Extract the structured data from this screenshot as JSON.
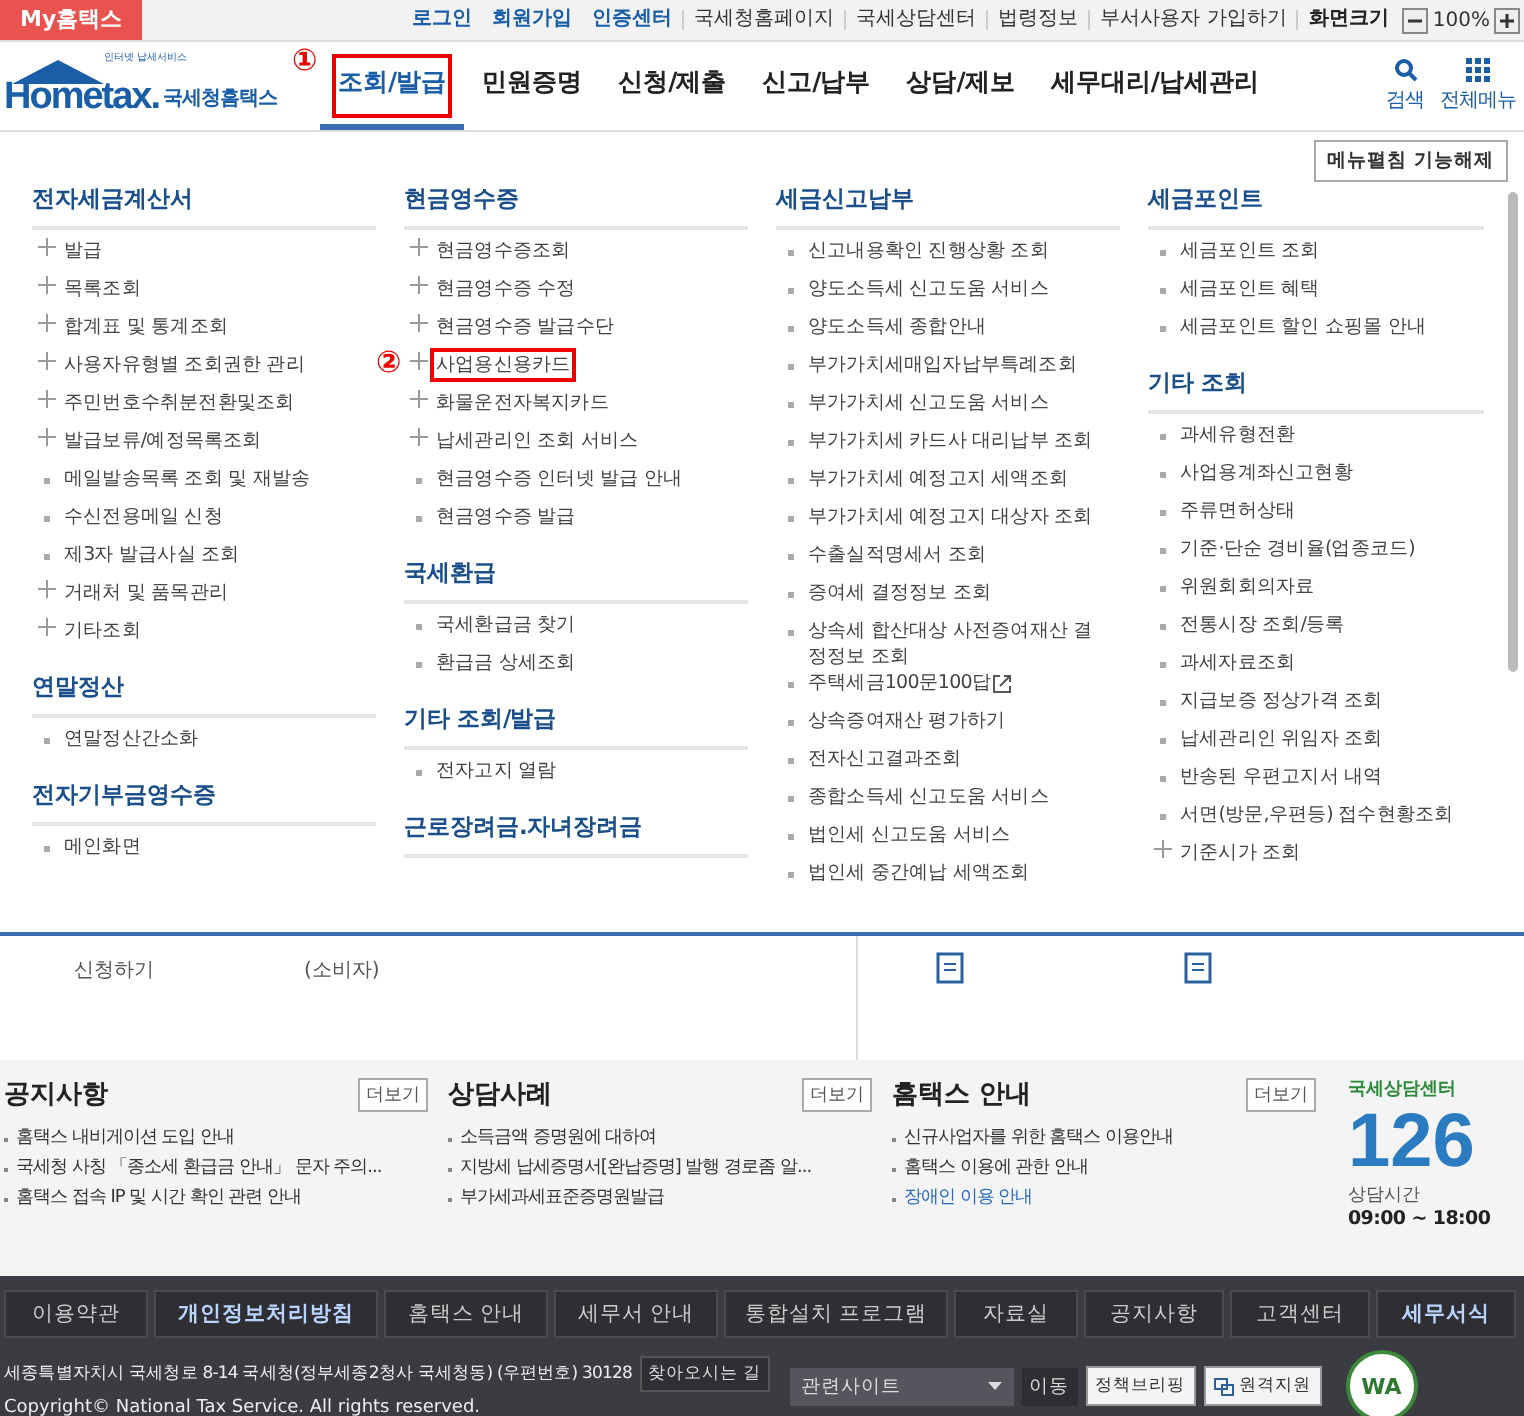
{
  "top_bar": {
    "my_tab": "My홈택스",
    "links": [
      {
        "label": "로그인",
        "kind": "strong"
      },
      {
        "label": "회원가입",
        "kind": "strong"
      },
      {
        "label": "인증센터",
        "kind": "strong"
      },
      {
        "label": "국세청홈페이지",
        "kind": "plain"
      },
      {
        "label": "국세상담센터",
        "kind": "plain"
      },
      {
        "label": "법령정보",
        "kind": "plain"
      },
      {
        "label": "부서사용자 가입하기",
        "kind": "plain"
      }
    ],
    "zoom_label": "화면크기",
    "zoom_value": "100%"
  },
  "header": {
    "logo_tagline": "인터넷 납세서비스",
    "logo_name": "Hometax.",
    "logo_korean": "국세청홈택스",
    "annotation": "①",
    "nav": [
      {
        "label": "조회/발급",
        "selected": true,
        "highlighted": true
      },
      {
        "label": "민원증명",
        "selected": false,
        "highlighted": false
      },
      {
        "label": "신청/제출",
        "selected": false,
        "highlighted": false
      },
      {
        "label": "신고/납부",
        "selected": false,
        "highlighted": false
      },
      {
        "label": "상담/제보",
        "selected": false,
        "highlighted": false
      },
      {
        "label": "세무대리/납세관리",
        "selected": false,
        "highlighted": false
      }
    ],
    "search": "검색",
    "all_menu": "전체메뉴"
  },
  "menu": {
    "toggle_button": "메뉴펼침 기능해제",
    "annotation": "②",
    "columns": [
      [
        {
          "title": "전자세금계산서",
          "items": [
            {
              "label": "발급",
              "kind": "plus",
              "highlighted": false
            },
            {
              "label": "목록조회",
              "kind": "plus",
              "highlighted": false
            },
            {
              "label": "합계표 및 통계조회",
              "kind": "plus",
              "highlighted": false
            },
            {
              "label": "사용자유형별 조회권한 관리",
              "kind": "plus",
              "highlighted": false
            },
            {
              "label": "주민번호수취분전환및조회",
              "kind": "plus",
              "highlighted": false
            },
            {
              "label": "발급보류/예정목록조회",
              "kind": "plus",
              "highlighted": false
            },
            {
              "label": "메일발송목록 조회 및 재발송",
              "kind": "dot",
              "highlighted": false
            },
            {
              "label": "수신전용메일 신청",
              "kind": "dot",
              "highlighted": false
            },
            {
              "label": "제3자 발급사실 조회",
              "kind": "dot",
              "highlighted": false
            },
            {
              "label": "거래처 및 품목관리",
              "kind": "plus",
              "highlighted": false
            },
            {
              "label": "기타조회",
              "kind": "plus",
              "highlighted": false
            }
          ]
        },
        {
          "title": "연말정산",
          "items": [
            {
              "label": "연말정산간소화",
              "kind": "dot",
              "highlighted": false
            }
          ]
        },
        {
          "title": "전자기부금영수증",
          "items": [
            {
              "label": "메인화면",
              "kind": "dot",
              "highlighted": false
            }
          ]
        }
      ],
      [
        {
          "title": "현금영수증",
          "items": [
            {
              "label": "현금영수증조회",
              "kind": "plus",
              "highlighted": false
            },
            {
              "label": "현금영수증 수정",
              "kind": "plus",
              "highlighted": false
            },
            {
              "label": "현금영수증 발급수단",
              "kind": "plus",
              "highlighted": false
            },
            {
              "label": "사업용신용카드",
              "kind": "plus",
              "highlighted": true
            },
            {
              "label": "화물운전자복지카드",
              "kind": "plus",
              "highlighted": false
            },
            {
              "label": "납세관리인 조회 서비스",
              "kind": "plus",
              "highlighted": false
            },
            {
              "label": "현금영수증 인터넷 발급 안내",
              "kind": "dot",
              "highlighted": false
            },
            {
              "label": "현금영수증 발급",
              "kind": "dot",
              "highlighted": false
            }
          ]
        },
        {
          "title": "국세환급",
          "items": [
            {
              "label": "국세환급금 찾기",
              "kind": "dot",
              "highlighted": false
            },
            {
              "label": "환급금 상세조회",
              "kind": "dot",
              "highlighted": false
            }
          ]
        },
        {
          "title": "기타 조회/발급",
          "items": [
            {
              "label": "전자고지 열람",
              "kind": "dot",
              "highlighted": false
            }
          ]
        },
        {
          "title": "근로장려금.자녀장려금"
        }
      ],
      [
        {
          "title": "세금신고납부",
          "items": [
            {
              "label": "신고내용확인 진행상황 조회",
              "kind": "dot",
              "highlighted": false
            },
            {
              "label": "양도소득세 신고도움 서비스",
              "kind": "dot",
              "highlighted": false
            },
            {
              "label": "양도소득세 종합안내",
              "kind": "dot",
              "highlighted": false
            },
            {
              "label": "부가가치세매입자납부특례조회",
              "kind": "dot",
              "highlighted": false
            },
            {
              "label": "부가가치세 신고도움 서비스",
              "kind": "dot",
              "highlighted": false
            },
            {
              "label": "부가가치세 카드사 대리납부 조회",
              "kind": "dot",
              "highlighted": false
            },
            {
              "label": "부가가치세 예정고지 세액조회",
              "kind": "dot",
              "highlighted": false
            },
            {
              "label": "부가가치세 예정고지 대상자 조회",
              "kind": "dot",
              "highlighted": false
            },
            {
              "label": "수출실적명세서 조회",
              "kind": "dot",
              "highlighted": false
            },
            {
              "label": "증여세 결정정보 조회",
              "kind": "dot",
              "highlighted": false
            },
            {
              "label": "상속세 합산대상 사전증여재산 결정정보 조회",
              "kind": "dot",
              "highlighted": false
            },
            {
              "label": "주택세금100문100답",
              "kind": "external",
              "highlighted": false
            },
            {
              "label": "상속증여재산 평가하기",
              "kind": "dot",
              "highlighted": false
            },
            {
              "label": "전자신고결과조회",
              "kind": "dot",
              "highlighted": false
            },
            {
              "label": "종합소득세 신고도움 서비스",
              "kind": "dot",
              "highlighted": false
            },
            {
              "label": "법인세 신고도움 서비스",
              "kind": "dot",
              "highlighted": false
            },
            {
              "label": "법인세 중간예납 세액조회",
              "kind": "dot",
              "highlighted": false
            }
          ]
        }
      ],
      [
        {
          "title": "세금포인트",
          "items": [
            {
              "label": "세금포인트 조회",
              "kind": "dot",
              "highlighted": false
            },
            {
              "label": "세금포인트 혜택",
              "kind": "dot",
              "highlighted": false
            },
            {
              "label": "세금포인트 할인 쇼핑몰 안내",
              "kind": "dot",
              "highlighted": false
            }
          ]
        },
        {
          "title": "기타 조회",
          "items": [
            {
              "label": "과세유형전환",
              "kind": "dot",
              "highlighted": false
            },
            {
              "label": "사업용계좌신고현황",
              "kind": "dot",
              "highlighted": false
            },
            {
              "label": "주류면허상태",
              "kind": "dot",
              "highlighted": false
            },
            {
              "label": "기준·단순 경비율(업종코드)",
              "kind": "dot",
              "highlighted": false
            },
            {
              "label": "위원회회의자료",
              "kind": "dot",
              "highlighted": false
            },
            {
              "label": "전통시장 조회/등록",
              "kind": "dot",
              "highlighted": false
            },
            {
              "label": "과세자료조회",
              "kind": "dot",
              "highlighted": false
            },
            {
              "label": "지급보증 정상가격 조회",
              "kind": "dot",
              "highlighted": false
            },
            {
              "label": "납세관리인 위임자 조회",
              "kind": "dot",
              "highlighted": false
            },
            {
              "label": "반송된 우편고지서 내역",
              "kind": "dot",
              "highlighted": false
            },
            {
              "label": "서면(방문,우편등) 접수현황조회",
              "kind": "dot",
              "highlighted": false
            },
            {
              "label": "기준시가 조회",
              "kind": "plus",
              "highlighted": false
            }
          ]
        }
      ]
    ]
  },
  "page_strip": {
    "texts": [
      "신청하기",
      "(소비자)"
    ]
  },
  "boards": [
    {
      "title": "공지사항",
      "more": "더보기",
      "items": [
        {
          "label": "홈택스 내비게이션 도입 안내",
          "kind": "plain"
        },
        {
          "label": "국세청 사칭 「종소세 환급금 안내」 문자 주의...",
          "kind": "plain"
        },
        {
          "label": "홈택스 접속 IP 및 시간 확인 관련 안내",
          "kind": "plain"
        }
      ]
    },
    {
      "title": "상담사례",
      "more": "더보기",
      "items": [
        {
          "label": "소득금액 증명원에 대하여",
          "kind": "plain"
        },
        {
          "label": "지방세 납세증명서[완납증명] 발행 경로좀 알...",
          "kind": "plain"
        },
        {
          "label": "부가세과세표준증명원발급",
          "kind": "plain"
        }
      ]
    },
    {
      "title": "홈택스 안내",
      "more": "더보기",
      "items": [
        {
          "label": "신규사업자를 위한 홈택스 이용안내",
          "kind": "plain"
        },
        {
          "label": "홈택스 이용에 관한 안내",
          "kind": "plain"
        },
        {
          "label": "장애인 이용 안내",
          "kind": "link"
        }
      ]
    }
  ],
  "call_center": {
    "title": "국세상담센터",
    "number": "126",
    "hours_label": "상담시간",
    "hours": "09:00 ~ 18:00"
  },
  "footer": {
    "links": [
      {
        "label": "이용약관",
        "highlighted": false
      },
      {
        "label": "개인정보처리방침",
        "highlighted": true
      },
      {
        "label": "홈택스 안내",
        "highlighted": false
      },
      {
        "label": "세무서 안내",
        "highlighted": false
      },
      {
        "label": "통합설치 프로그램",
        "highlighted": false
      },
      {
        "label": "자료실",
        "highlighted": false
      },
      {
        "label": "공지사항",
        "highlighted": false
      },
      {
        "label": "고객센터",
        "highlighted": false
      },
      {
        "label": "세무서식",
        "highlighted": true
      }
    ],
    "address": "세종특별자치시 국세청로 8-14 국세청(정부세종2청사 국세청동) (우편번호) 30128",
    "directions": "찾아오시는 길",
    "copyright": "Copyright© National Tax Service. All rights reserved.",
    "related_sites": "관련사이트",
    "go": "이동",
    "briefing": "정책브리핑",
    "remote": "원격지원",
    "badge": "WA"
  }
}
